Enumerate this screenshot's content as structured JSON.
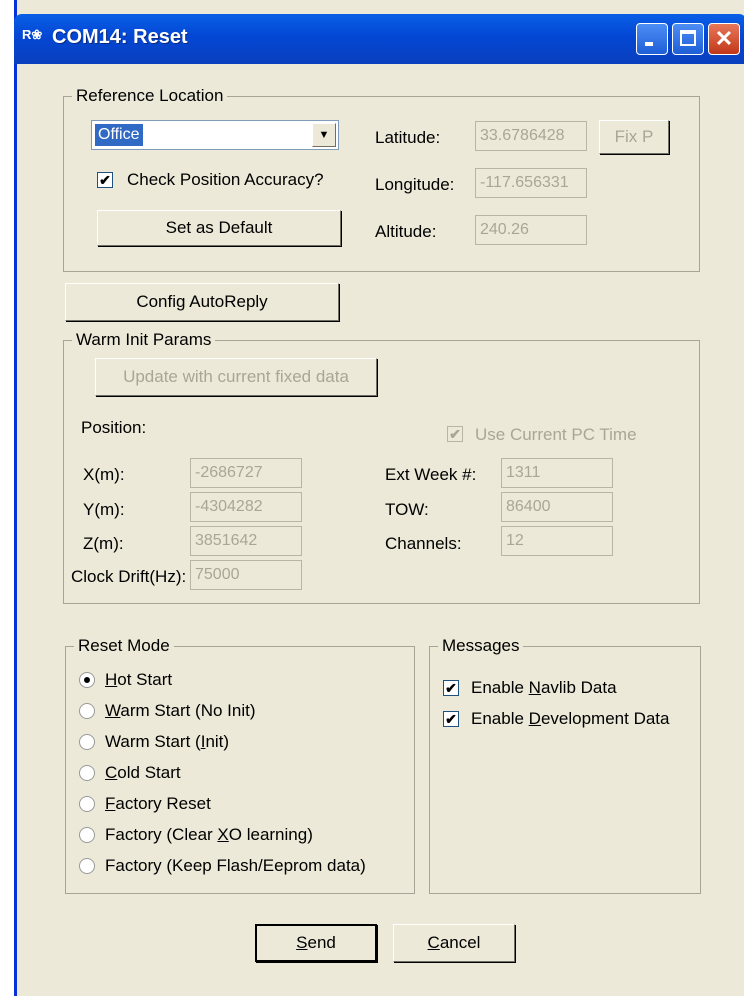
{
  "window": {
    "title": "COM14: Reset",
    "icon": "rx-app-icon"
  },
  "reference_location": {
    "legend": "Reference Location",
    "location_select": "Office",
    "check_accuracy_label": "Check Position Accuracy?",
    "check_accuracy_checked": true,
    "set_default_label": "Set as Default",
    "latitude_label": "Latitude:",
    "latitude_value": "33.6786428",
    "longitude_label": "Longitude:",
    "longitude_value": "-117.656331",
    "altitude_label": "Altitude:",
    "altitude_value": "240.26",
    "fixp_label": "Fix P"
  },
  "config_autoreply_label": "Config AutoReply",
  "warm_init": {
    "legend": "Warm Init Params",
    "update_label": "Update with current fixed data",
    "position_label": "Position:",
    "use_pc_time_label": "Use Current PC Time",
    "x_label": "X(m):",
    "x_value": "-2686727",
    "y_label": "Y(m):",
    "y_value": "-4304282",
    "z_label": "Z(m):",
    "z_value": "3851642",
    "clock_label": "Clock Drift(Hz):",
    "clock_value": "75000",
    "week_label": "Ext Week #:",
    "week_value": "1311",
    "tow_label": "TOW:",
    "tow_value": "86400",
    "channels_label": "Channels:",
    "channels_value": "12"
  },
  "reset_mode": {
    "legend": "Reset Mode",
    "options": [
      {
        "pre": "",
        "u": "H",
        "post": "ot Start",
        "selected": true
      },
      {
        "pre": "",
        "u": "W",
        "post": "arm Start (No Init)",
        "selected": false
      },
      {
        "pre": "Warm Start (",
        "u": "I",
        "post": "nit)",
        "selected": false
      },
      {
        "pre": "",
        "u": "C",
        "post": "old Start",
        "selected": false
      },
      {
        "pre": "",
        "u": "F",
        "post": "actory Reset",
        "selected": false
      },
      {
        "pre": "Factory (Clear ",
        "u": "X",
        "post": "O learning)",
        "selected": false
      },
      {
        "pre": "Factory (Keep Flash/Eeprom data)",
        "u": "",
        "post": "",
        "selected": false
      }
    ]
  },
  "messages": {
    "legend": "Messages",
    "navlib": {
      "pre": "Enable ",
      "u": "N",
      "post": "avlib Data",
      "checked": true
    },
    "dev": {
      "pre": "Enable ",
      "u": "D",
      "post": "evelopment Data",
      "checked": true
    }
  },
  "buttons": {
    "send": {
      "pre": "",
      "u": "S",
      "post": "end"
    },
    "cancel": {
      "pre": "",
      "u": "C",
      "post": "ancel"
    }
  }
}
